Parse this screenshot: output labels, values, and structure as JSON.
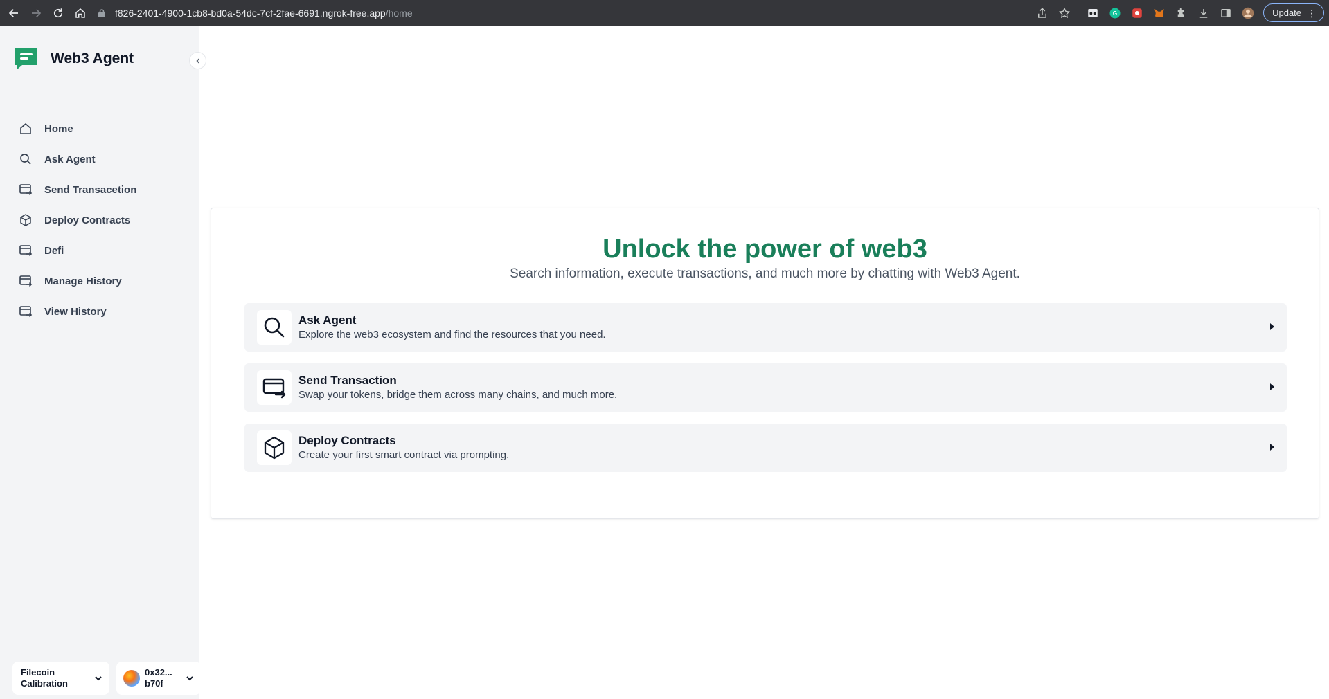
{
  "browser": {
    "url_host": "f826-2401-4900-1cb8-bd0a-54dc-7cf-2fae-6691.ngrok-free.app",
    "url_path": "/home",
    "update_label": "Update"
  },
  "sidebar": {
    "brand": "Web3 Agent",
    "items": [
      {
        "label": "Home",
        "icon": "home-icon"
      },
      {
        "label": "Ask Agent",
        "icon": "search-icon"
      },
      {
        "label": "Send Transacetion",
        "icon": "card-transfer-icon"
      },
      {
        "label": "Deploy Contracts",
        "icon": "cube-icon"
      },
      {
        "label": "Defi",
        "icon": "card-transfer-icon"
      },
      {
        "label": "Manage History",
        "icon": "card-transfer-icon"
      },
      {
        "label": "View History",
        "icon": "card-transfer-icon"
      }
    ],
    "network": {
      "line1": "Filecoin",
      "line2": "Calibration"
    },
    "account": {
      "line1": "0x32...",
      "line2": "b70f"
    }
  },
  "main": {
    "title": "Unlock the power of web3",
    "subtitle": "Search information, execute transactions, and much more by chatting with Web3 Agent.",
    "options": [
      {
        "title": "Ask Agent",
        "desc": "Explore the web3 ecosystem and find the resources that you need.",
        "icon": "search-icon"
      },
      {
        "title": "Send Transaction",
        "desc": "Swap your tokens, bridge them across many chains, and much more.",
        "icon": "card-transfer-icon"
      },
      {
        "title": "Deploy Contracts",
        "desc": "Create your first smart contract via prompting.",
        "icon": "cube-icon"
      }
    ]
  },
  "colors": {
    "accent_green": "#1a7f5a",
    "chrome_bg": "#35363a",
    "sidebar_bg": "#f3f4f6"
  }
}
